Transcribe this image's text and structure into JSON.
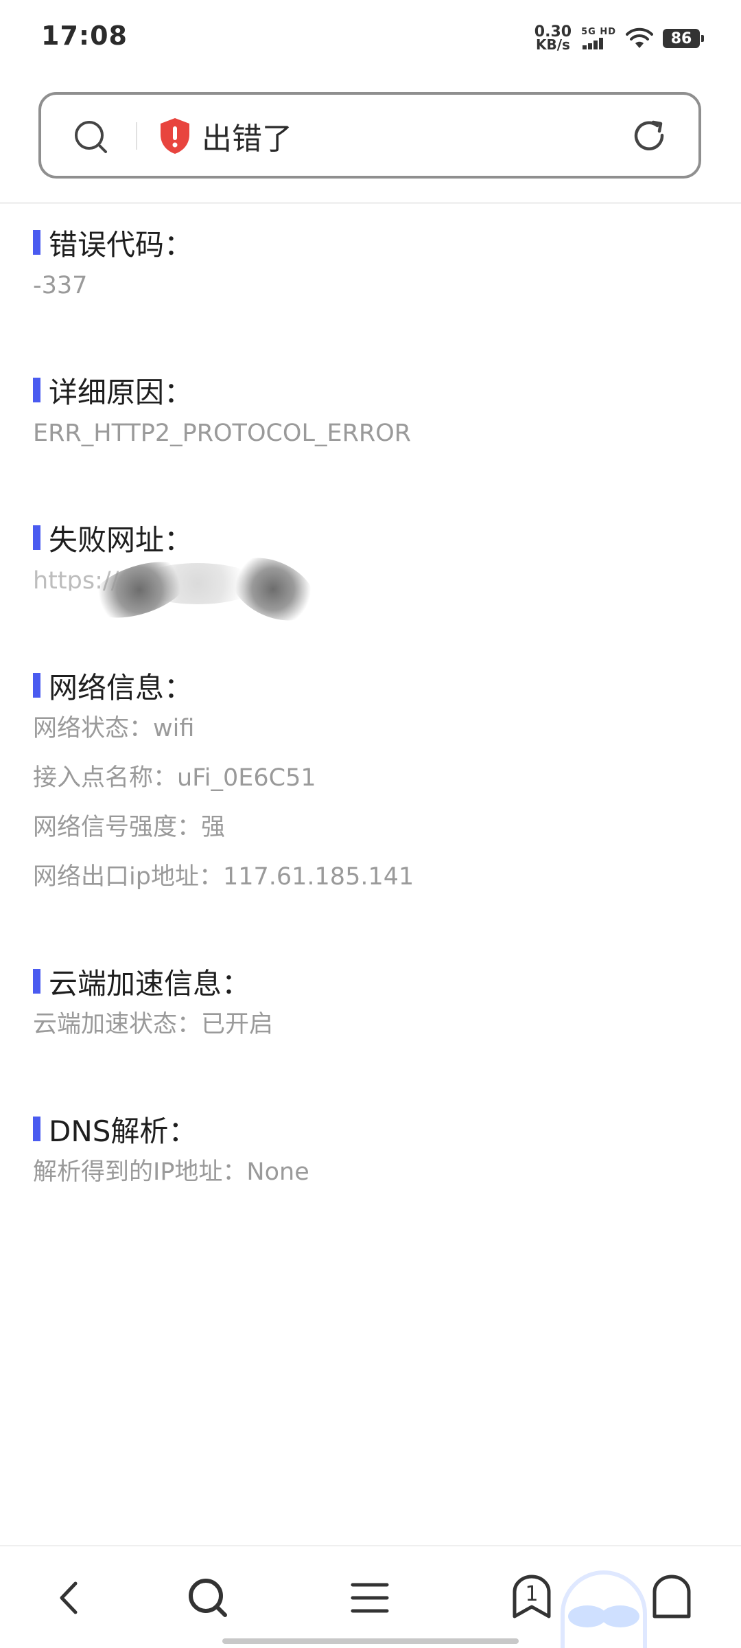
{
  "status_bar": {
    "time": "17:08",
    "net_speed_value": "0.30",
    "net_speed_unit": "KB/s",
    "network_label": "5G HD",
    "battery": "86"
  },
  "address_bar": {
    "title": "出错了",
    "search_icon": "search-icon",
    "security_icon": "shield-error-icon",
    "reload_icon": "reload-icon"
  },
  "sections": {
    "error_code": {
      "title": "错误代码：",
      "value": "-337"
    },
    "detail_reason": {
      "title": "详细原因：",
      "value": "ERR_HTTP2_PROTOCOL_ERROR"
    },
    "failed_url": {
      "title": "失败网址：",
      "value": "https://"
    },
    "network_info": {
      "title": "网络信息：",
      "lines": [
        "网络状态：wifi",
        "接入点名称：uFi_0E6C51",
        "网络信号强度：强",
        "网络出口ip地址：117.61.185.141"
      ]
    },
    "cloud_accel": {
      "title": "云端加速信息：",
      "lines": [
        "云端加速状态：已开启"
      ]
    },
    "dns": {
      "title": "DNS解析：",
      "lines": [
        "解析得到的IP地址：None"
      ]
    }
  },
  "bottom_nav": {
    "back_icon": "back-icon",
    "search_icon": "search-icon",
    "menu_icon": "menu-icon",
    "tabs_count": "1",
    "home_icon": "home-icon"
  },
  "colors": {
    "accent_bar": "#4a5bf0",
    "error_red": "#e8443e",
    "secondary_text": "#9a9a9a"
  }
}
